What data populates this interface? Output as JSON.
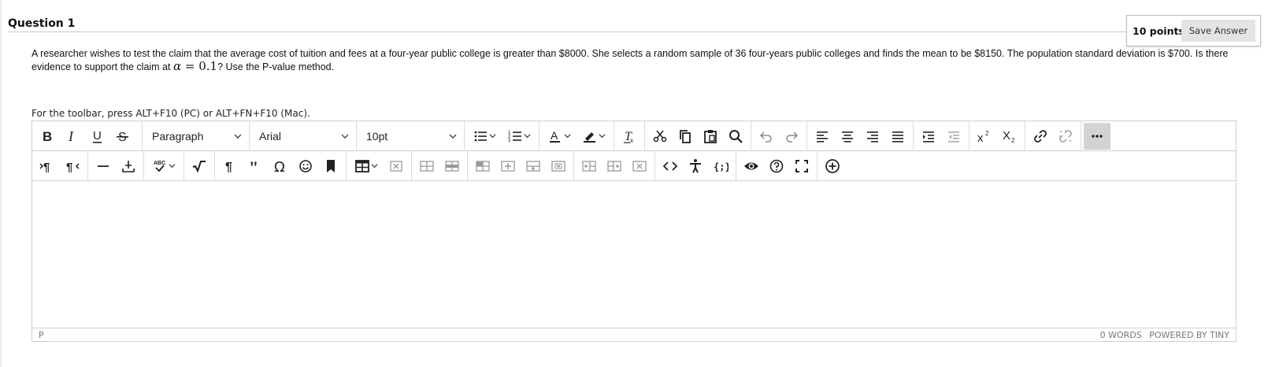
{
  "question": {
    "title": "Question 1",
    "points": "10 points",
    "save_label": "Save Answer",
    "text_before": "A researcher wishes to test the claim that the average cost of tuition and fees at a four-year public college is greater than $8000. She selects a random sample of 36 four-years public colleges and finds the mean to be $8150. The population standard deviation is $700. Is there evidence to support the claim at ",
    "math_alpha": "α",
    "math_rest": " = 0.1",
    "text_after": "? Use the P-value method."
  },
  "editor": {
    "toolbar_hint": "For the toolbar, press ALT+F10 (PC) or ALT+FN+F10 (Mac).",
    "block_format": "Paragraph",
    "font_family": "Arial",
    "font_size": "10pt",
    "spellcheck_label": "ABC",
    "status_path": "P",
    "word_count": "0 WORDS",
    "powered_by": "POWERED BY TINY",
    "colors": {
      "border": "#cfcfcf",
      "more_button_bg": "#d3d3d3",
      "save_button_bg": "#e4e4e4"
    }
  }
}
